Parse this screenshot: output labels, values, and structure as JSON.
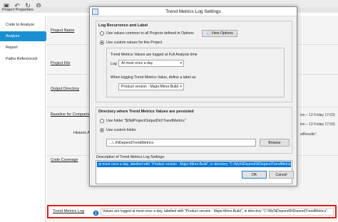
{
  "window": {
    "title": "Project Properties"
  },
  "nav": {
    "items": [
      {
        "label": "Code to Analyze"
      },
      {
        "label": "Analyze"
      },
      {
        "label": "Report"
      },
      {
        "label": "Paths Referenced"
      }
    ]
  },
  "rows": {
    "project_name": "Project Name",
    "project_file": "Project File",
    "output_directory": "Output Directory",
    "baseline": "Baseline for Comparison",
    "historic": "Historic A",
    "code_coverage": "Code Coverage"
  },
  "side_texts": {
    "b1": "ion – 12 Friday 17:03)",
    "b2": "ion – 12 Friday 17:03)",
    "results": "alResults\"."
  },
  "dialog": {
    "title": "Trend Metrics Log Settings",
    "recurrence": {
      "group_title": "Log Recurrence and Label",
      "radio_all": "Use values common to all Projects defined in Options",
      "view_options": "View Options",
      "radio_custom": "Use custom values for this Project",
      "logged_note": "Trend Metrics Values are logged at Full Analysis time",
      "log_label": "Log",
      "log_value": "At most once a day",
      "label_note": "When logging Trend Metrics Value, define a label as",
      "label_value": "Product version : Major.Minor.Build"
    },
    "directory": {
      "group_title": "Directory where Trend Metrics Values are persisted",
      "radio_folder": "Use folder  \"$(NdProjectOutputDir)\\TrendMetrics\"",
      "radio_custom": "Use custom folder",
      "path_value": "...\\..\\NDependTrendMetrics",
      "browse": "Browse"
    },
    "description": {
      "label": "Description of Trend Metrics Log Settings:",
      "text": "at most once a day, labelled with \"Product version : Major.Minor.Build\", in directory \"C:\\My\\NDepend\\NDependTrendMetrics\""
    },
    "ok": "OK",
    "cancel": "Cancel"
  },
  "trend_row": {
    "label": "Trend Metrics Log",
    "value": "Values are logged at most once a day, labelled with \"Product version : Major.Minor.Build\", in directory \"C:\\My\\NDepend\\NDependTrendMetrics\"."
  },
  "colors": {
    "accent": "#1c8fd0",
    "highlight": "#0078d7",
    "callout": "#e02020"
  }
}
